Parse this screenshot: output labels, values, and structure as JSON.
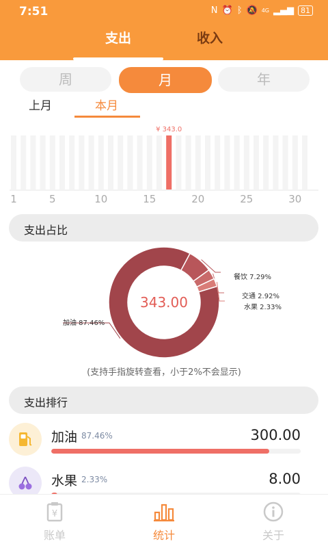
{
  "status_bar": {
    "time": "7:51",
    "battery": "81",
    "network": "4G"
  },
  "header": {
    "tabs": [
      {
        "label": "支出",
        "active": true
      },
      {
        "label": "收入",
        "active": false
      }
    ]
  },
  "period_selector": {
    "options": [
      {
        "label": "周",
        "active": false
      },
      {
        "label": "月",
        "active": true
      },
      {
        "label": "年",
        "active": false
      }
    ]
  },
  "month_tabs": [
    {
      "label": "上月",
      "active": false
    },
    {
      "label": "本月",
      "active": true
    }
  ],
  "colors": {
    "accent": "#f58a3c",
    "header": "#f99a3c",
    "bar": "#ef6f66",
    "donut_main": "#a1454b"
  },
  "chart_data": [
    {
      "type": "bar",
      "x": [
        1,
        2,
        3,
        4,
        5,
        6,
        7,
        8,
        9,
        10,
        11,
        12,
        13,
        14,
        15,
        16,
        17,
        18,
        19,
        20,
        21,
        22,
        23,
        24,
        25,
        26,
        27,
        28,
        29,
        30,
        31
      ],
      "values": [
        0,
        0,
        0,
        0,
        0,
        0,
        0,
        0,
        0,
        0,
        0,
        0,
        0,
        0,
        0,
        0,
        343.0,
        0,
        0,
        0,
        0,
        0,
        0,
        0,
        0,
        0,
        0,
        0,
        0,
        0,
        0
      ],
      "xticks": [
        "1",
        "5",
        "10",
        "15",
        "20",
        "25",
        "30"
      ],
      "peak_label": "¥ 343.0"
    },
    {
      "type": "pie",
      "center_label": "343.00",
      "slices": [
        {
          "name": "加油",
          "percent": 87.46,
          "label": "加油 87.46%",
          "color": "#a1454b"
        },
        {
          "name": "餐饮",
          "percent": 7.29,
          "label": "餐饮 7.29%",
          "color": "#b8565a"
        },
        {
          "name": "交通",
          "percent": 2.92,
          "label": "交通 2.92%",
          "color": "#c96a6a"
        },
        {
          "name": "水果",
          "percent": 2.33,
          "label": "水果 2.33%",
          "color": "#d97c77"
        }
      ]
    }
  ],
  "sections": {
    "proportion_title": "支出占比",
    "ranking_title": "支出排行"
  },
  "hint": "(支持手指旋转查看，小于2%不会显示)",
  "ranking": [
    {
      "name": "加油",
      "percent_label": "87.46%",
      "amount": "300.00",
      "fraction": 0.8746,
      "icon": "fuel-pump-icon",
      "icon_bg": "#fdf0d6",
      "icon_color": "#f5b731"
    },
    {
      "name": "水果",
      "percent_label": "2.33%",
      "amount": "8.00",
      "fraction": 0.0233,
      "icon": "cherry-icon",
      "icon_bg": "#ece8f8",
      "icon_color": "#9b6fe0"
    }
  ],
  "bottom_nav": [
    {
      "label": "账单",
      "icon": "bill-icon",
      "active": false
    },
    {
      "label": "统计",
      "icon": "chart-icon",
      "active": true
    },
    {
      "label": "关于",
      "icon": "info-icon",
      "active": false
    }
  ]
}
